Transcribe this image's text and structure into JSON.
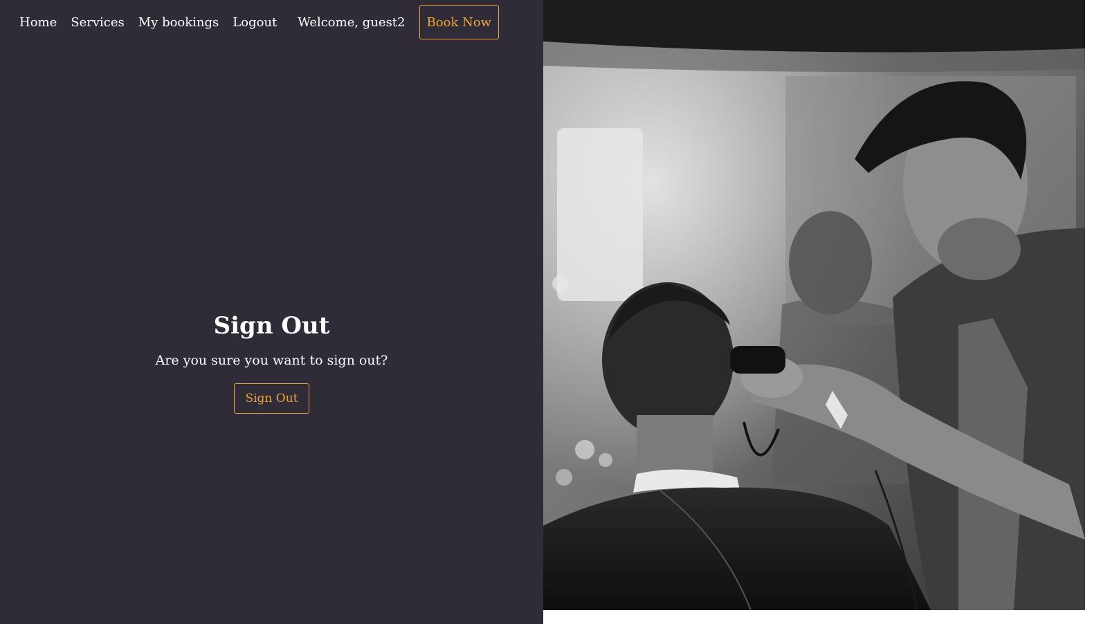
{
  "nav": {
    "home": "Home",
    "services": "Services",
    "bookings": "My bookings",
    "logout": "Logout",
    "welcome": "Welcome, guest2",
    "book_now": "Book Now"
  },
  "main": {
    "title": "Sign Out",
    "prompt": "Are you sure you want to sign out?",
    "button": "Sign Out"
  },
  "colors": {
    "panel_bg": "#2f2c38",
    "accent": "#f0a33a",
    "text": "#ffffff"
  },
  "hero_image": {
    "subject": "barber-photo"
  }
}
